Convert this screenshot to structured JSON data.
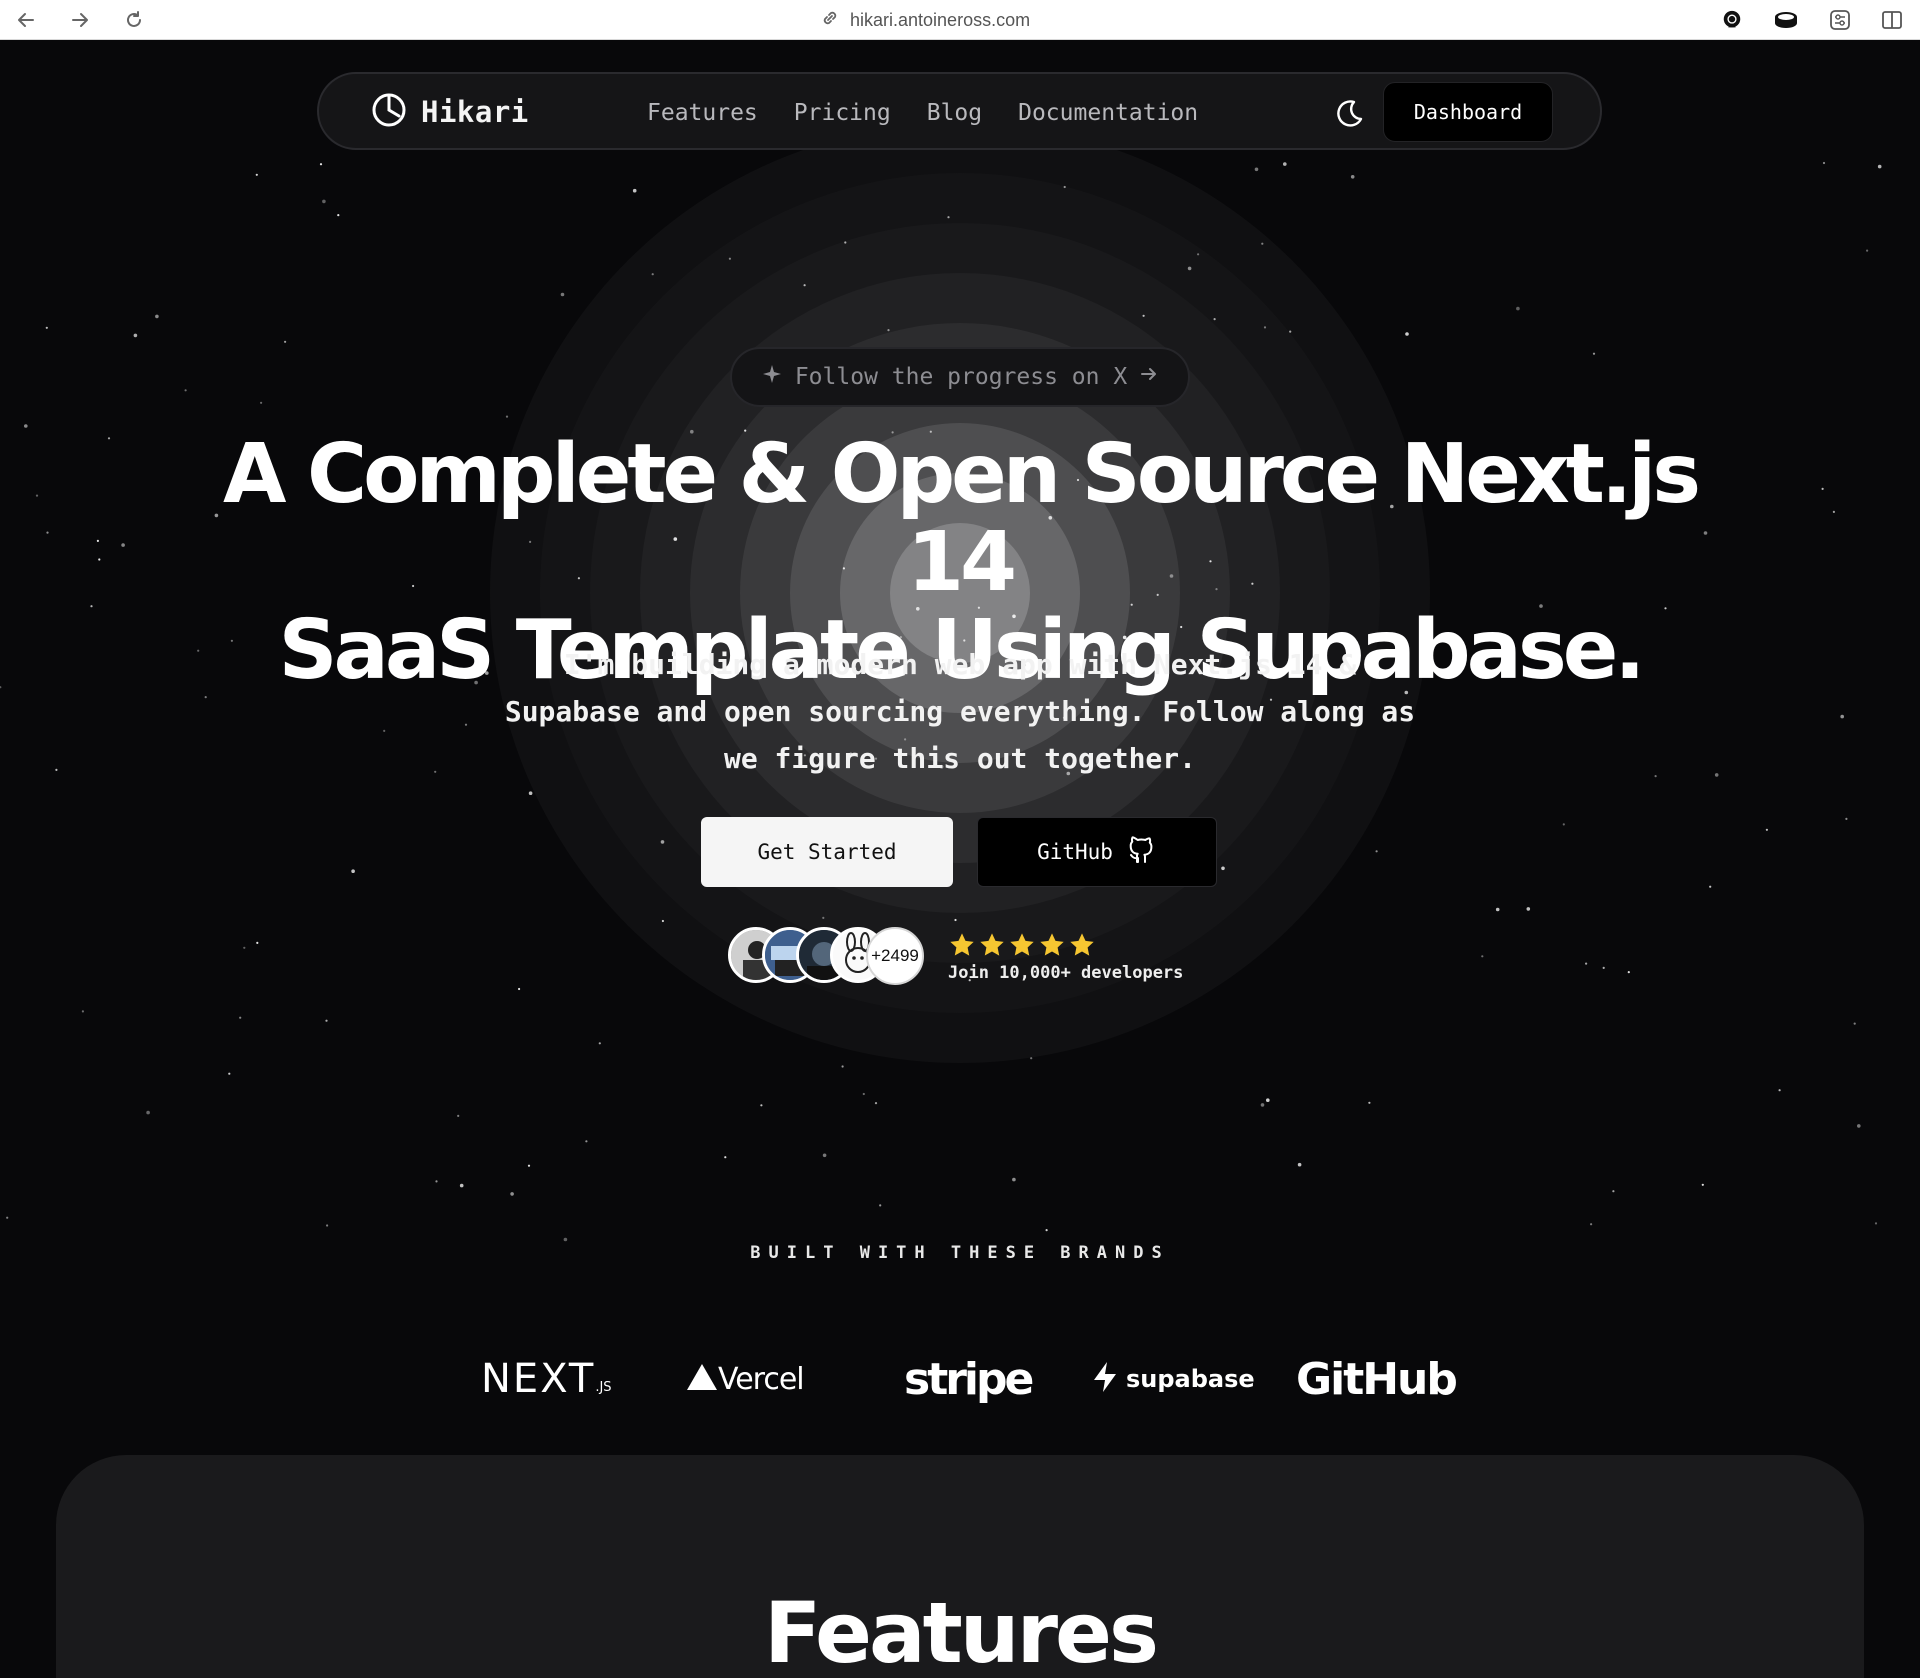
{
  "browser": {
    "url": "hikari.antoineross.com"
  },
  "nav": {
    "brand": "Hikari",
    "links": [
      "Features",
      "Pricing",
      "Blog",
      "Documentation"
    ],
    "dashboard_label": "Dashboard"
  },
  "hero": {
    "pill_text": "Follow the progress on X",
    "title_line1": "A Complete & Open Source Next.js 14",
    "title_line2": "SaaS Template Using Supabase.",
    "subtitle_line1": "I'm building a modern web app with Next.js 14 &",
    "subtitle_line2": "Supabase and open sourcing everything. Follow along as",
    "subtitle_line3": "we figure this out together.",
    "primary_button": "Get Started",
    "secondary_button": "GitHub",
    "avatar_count": "+2499",
    "rating_stars": 5,
    "join_text": "Join 10,000+ developers"
  },
  "brands": {
    "title": "BUILT WITH THESE BRANDS",
    "logos": {
      "next_main": "NEXT",
      "next_suffix": ".JS",
      "vercel": "Vercel",
      "stripe": "stripe",
      "supabase": "supabase",
      "github": "GitHub"
    }
  },
  "features": {
    "title": "Features"
  },
  "colors": {
    "background": "#08080a",
    "star_yellow": "#f6c631",
    "card": "#1a1a1c"
  }
}
